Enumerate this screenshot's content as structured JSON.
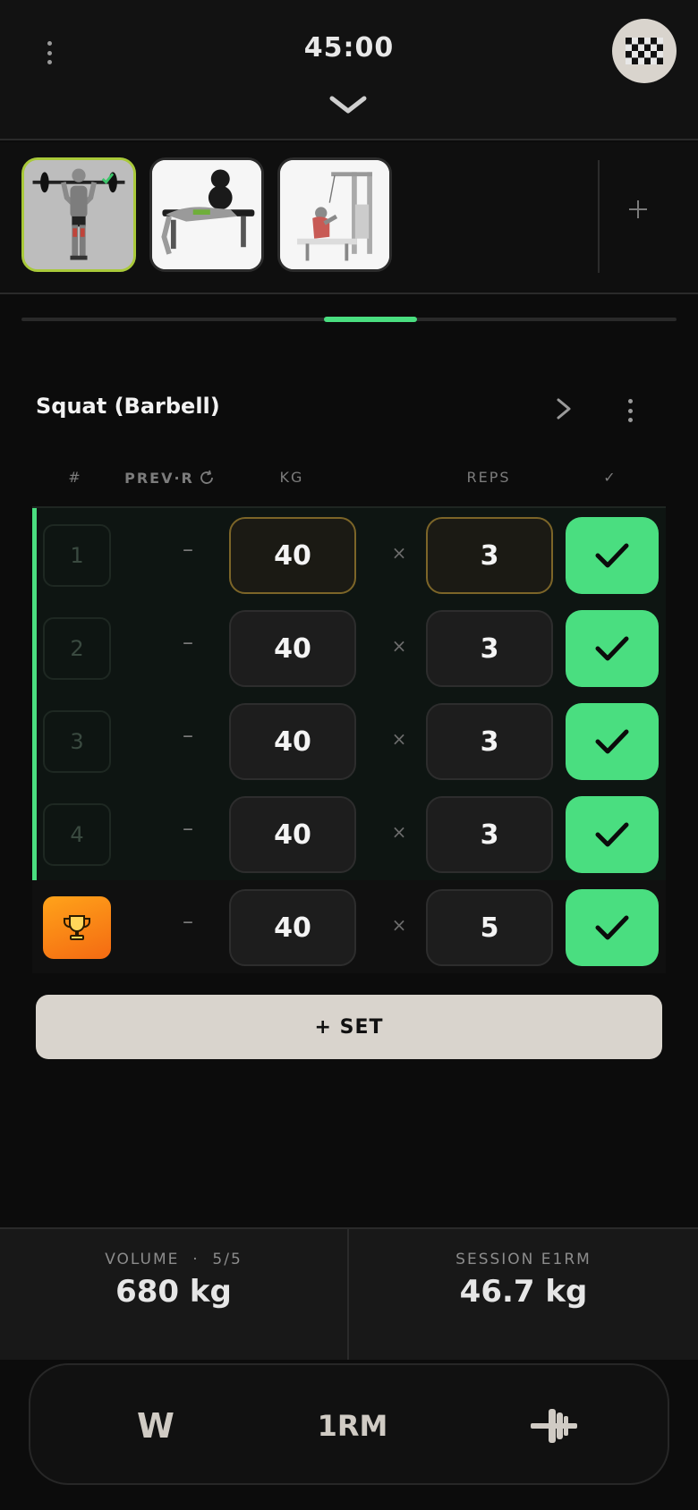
{
  "header": {
    "timer": "45:00"
  },
  "exercises": [
    {
      "name": "overhead-press-thumbnail",
      "active": true
    },
    {
      "name": "bench-press-thumbnail",
      "active": false
    },
    {
      "name": "cable-row-thumbnail",
      "active": false
    }
  ],
  "progress": {
    "segment": 4,
    "of": 7
  },
  "exercise": {
    "title": "Squat (Barbell)"
  },
  "columns": {
    "num": "#",
    "prev": "PREV·R",
    "kg": "KG",
    "reps": "REPS",
    "check": "✓"
  },
  "sets": [
    {
      "num": "1",
      "prev": "–",
      "kg": "40",
      "times": "×",
      "reps": "3",
      "completed": true,
      "focused": true
    },
    {
      "num": "2",
      "prev": "–",
      "kg": "40",
      "times": "×",
      "reps": "3",
      "completed": true,
      "focused": false
    },
    {
      "num": "3",
      "prev": "–",
      "kg": "40",
      "times": "×",
      "reps": "3",
      "completed": true,
      "focused": false
    },
    {
      "num": "4",
      "prev": "–",
      "kg": "40",
      "times": "×",
      "reps": "3",
      "completed": true,
      "focused": false
    },
    {
      "num": "",
      "prev": "–",
      "kg": "40",
      "times": "×",
      "reps": "5",
      "completed": true,
      "focused": false,
      "pr": true
    }
  ],
  "add_set_label": "+ SET",
  "stats": {
    "volume_label": "VOLUME  ·  5/5",
    "volume_value": "680 kg",
    "e1rm_label": "SESSION E1RM",
    "e1rm_value": "46.7 kg"
  },
  "toolbar": {
    "w_label": "W",
    "rm_label": "1RM",
    "plate_icon": "barbell-plate-icon"
  },
  "colors": {
    "accent": "#4ade80",
    "pr_orange": "#f58a14",
    "active_thumb_border": "#a9c93a",
    "light_button": "#d9d4cd"
  }
}
